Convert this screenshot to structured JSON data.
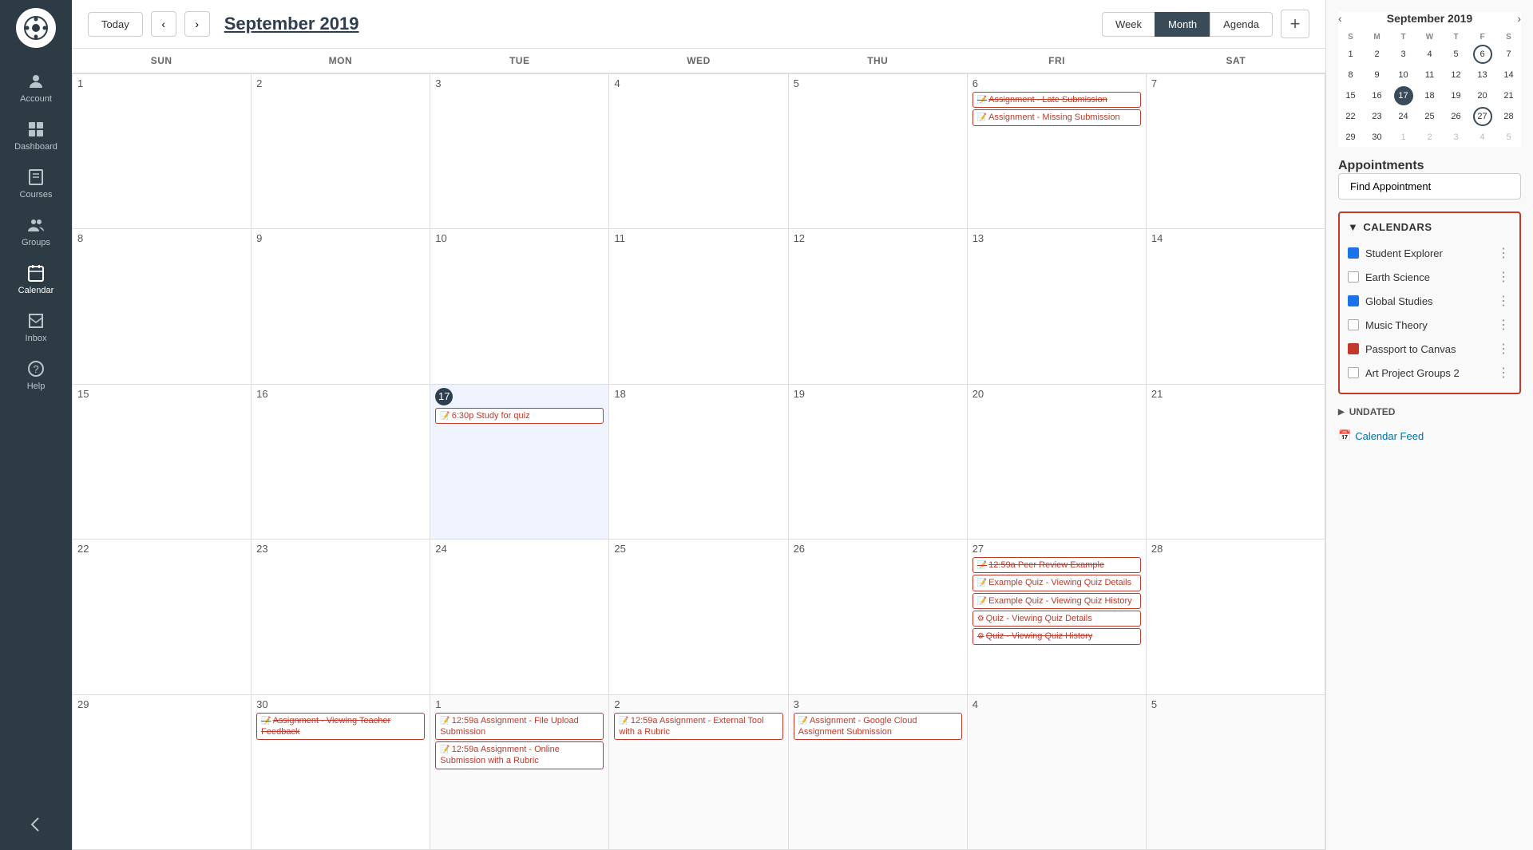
{
  "sidebar": {
    "logo": "🎓",
    "items": [
      {
        "id": "account",
        "label": "Account",
        "icon": "person"
      },
      {
        "id": "dashboard",
        "label": "Dashboard",
        "icon": "dashboard"
      },
      {
        "id": "courses",
        "label": "Courses",
        "icon": "courses"
      },
      {
        "id": "groups",
        "label": "Groups",
        "icon": "groups"
      },
      {
        "id": "calendar",
        "label": "Calendar",
        "icon": "calendar",
        "active": true
      },
      {
        "id": "inbox",
        "label": "Inbox",
        "icon": "inbox"
      },
      {
        "id": "help",
        "label": "Help",
        "icon": "help"
      }
    ],
    "collapse_label": "←"
  },
  "header": {
    "today_label": "Today",
    "title": "September 2019",
    "view_week": "Week",
    "view_month": "Month",
    "view_agenda": "Agenda",
    "add_icon": "+"
  },
  "day_headers": [
    "SUN",
    "MON",
    "TUE",
    "WED",
    "THU",
    "FRI",
    "SAT"
  ],
  "mini_cal": {
    "title": "September 2019",
    "day_headers": [
      "S",
      "M",
      "T",
      "W",
      "T",
      "F",
      "S"
    ],
    "days": [
      {
        "num": "1",
        "other": false
      },
      {
        "num": "2",
        "other": false
      },
      {
        "num": "3",
        "other": false
      },
      {
        "num": "4",
        "other": false
      },
      {
        "num": "5",
        "other": false
      },
      {
        "num": "6",
        "other": false,
        "selected": true
      },
      {
        "num": "7",
        "other": false
      },
      {
        "num": "8",
        "other": false
      },
      {
        "num": "9",
        "other": false
      },
      {
        "num": "10",
        "other": false
      },
      {
        "num": "11",
        "other": false
      },
      {
        "num": "12",
        "other": false
      },
      {
        "num": "13",
        "other": false
      },
      {
        "num": "14",
        "other": false
      },
      {
        "num": "15",
        "other": false
      },
      {
        "num": "16",
        "other": false
      },
      {
        "num": "17",
        "other": false,
        "today": true
      },
      {
        "num": "18",
        "other": false
      },
      {
        "num": "19",
        "other": false
      },
      {
        "num": "20",
        "other": false
      },
      {
        "num": "21",
        "other": false
      },
      {
        "num": "22",
        "other": false
      },
      {
        "num": "23",
        "other": false
      },
      {
        "num": "24",
        "other": false
      },
      {
        "num": "25",
        "other": false
      },
      {
        "num": "26",
        "other": false
      },
      {
        "num": "27",
        "other": false,
        "selected2": true
      },
      {
        "num": "28",
        "other": false
      },
      {
        "num": "29",
        "other": false
      },
      {
        "num": "30",
        "other": false
      },
      {
        "num": "1",
        "other": true
      },
      {
        "num": "2",
        "other": true
      },
      {
        "num": "3",
        "other": true
      },
      {
        "num": "4",
        "other": true
      },
      {
        "num": "5",
        "other": true
      }
    ]
  },
  "appointments": {
    "section_label": "Appointments",
    "find_button": "Find Appointment"
  },
  "calendars": {
    "section_label": "CALENDARS",
    "items": [
      {
        "name": "Student Explorer",
        "color": "#1a73e8",
        "checked": true
      },
      {
        "name": "Earth Science",
        "color": null,
        "checked": false
      },
      {
        "name": "Global Studies",
        "color": "#1a73e8",
        "checked": true
      },
      {
        "name": "Music Theory",
        "color": null,
        "checked": false
      },
      {
        "name": "Passport to Canvas",
        "color": "#c0392b",
        "checked": true
      },
      {
        "name": "Art Project Groups 2",
        "color": null,
        "checked": false
      }
    ]
  },
  "undated": {
    "label": "UNDATED"
  },
  "calendar_feed": {
    "label": "Calendar Feed"
  },
  "weeks": [
    {
      "days": [
        {
          "num": "1",
          "current": true,
          "events": []
        },
        {
          "num": "2",
          "current": true,
          "events": []
        },
        {
          "num": "3",
          "current": true,
          "events": []
        },
        {
          "num": "4",
          "current": true,
          "events": []
        },
        {
          "num": "5",
          "current": true,
          "events": []
        },
        {
          "num": "6",
          "current": true,
          "events": [
            {
              "text": "Assignment - Late Submission",
              "icon": "📝",
              "strikethrough": true
            },
            {
              "text": "Assignment - Missing Submission",
              "icon": "📝",
              "strikethrough": false
            }
          ]
        },
        {
          "num": "7",
          "current": true,
          "events": []
        }
      ]
    },
    {
      "days": [
        {
          "num": "8",
          "current": true,
          "events": []
        },
        {
          "num": "9",
          "current": true,
          "events": []
        },
        {
          "num": "10",
          "current": true,
          "events": []
        },
        {
          "num": "11",
          "current": true,
          "events": []
        },
        {
          "num": "12",
          "current": true,
          "events": []
        },
        {
          "num": "13",
          "current": true,
          "events": []
        },
        {
          "num": "14",
          "current": true,
          "events": []
        }
      ]
    },
    {
      "days": [
        {
          "num": "15",
          "current": true,
          "events": []
        },
        {
          "num": "16",
          "current": true,
          "events": []
        },
        {
          "num": "17",
          "current": true,
          "today": true,
          "events": [
            {
              "text": "6:30p Study for quiz",
              "icon": "📝",
              "strikethrough": false
            }
          ]
        },
        {
          "num": "18",
          "current": true,
          "events": []
        },
        {
          "num": "19",
          "current": true,
          "events": []
        },
        {
          "num": "20",
          "current": true,
          "events": []
        },
        {
          "num": "21",
          "current": true,
          "events": []
        }
      ]
    },
    {
      "days": [
        {
          "num": "22",
          "current": true,
          "events": []
        },
        {
          "num": "23",
          "current": true,
          "events": []
        },
        {
          "num": "24",
          "current": true,
          "events": []
        },
        {
          "num": "25",
          "current": true,
          "events": []
        },
        {
          "num": "26",
          "current": true,
          "events": []
        },
        {
          "num": "27",
          "current": true,
          "events": [
            {
              "text": "12:59a Peer Review Example",
              "icon": "📝",
              "strikethrough": true
            },
            {
              "text": "Example Quiz - Viewing Quiz Details",
              "icon": "📝",
              "strikethrough": false
            },
            {
              "text": "Example Quiz - Viewing Quiz History",
              "icon": "📝",
              "strikethrough": false
            },
            {
              "text": "Quiz - Viewing Quiz Details",
              "icon": "⚙",
              "strikethrough": false
            },
            {
              "text": "Quiz - Viewing Quiz History",
              "icon": "⚙",
              "strikethrough": true
            }
          ]
        },
        {
          "num": "28",
          "current": true,
          "events": []
        }
      ]
    },
    {
      "days": [
        {
          "num": "29",
          "current": true,
          "events": []
        },
        {
          "num": "30",
          "current": true,
          "events": [
            {
              "text": "Assignment - Viewing Teacher Feedback",
              "icon": "📝",
              "strikethrough": true
            }
          ]
        },
        {
          "num": "1",
          "current": false,
          "events": [
            {
              "text": "12:59a Assignment - File Upload Submission",
              "icon": "📝",
              "strikethrough": false
            },
            {
              "text": "12:59a Assignment - Online Submission with a Rubric",
              "icon": "📝",
              "strikethrough": false
            }
          ]
        },
        {
          "num": "2",
          "current": false,
          "events": [
            {
              "text": "12:59a Assignment - External Tool with a Rubric",
              "icon": "📝",
              "strikethrough": false
            }
          ]
        },
        {
          "num": "3",
          "current": false,
          "events": [
            {
              "text": "Assignment - Google Cloud Assignment Submission",
              "icon": "📝",
              "strikethrough": false
            }
          ]
        },
        {
          "num": "4",
          "current": false,
          "events": []
        },
        {
          "num": "5",
          "current": false,
          "events": []
        }
      ]
    }
  ]
}
